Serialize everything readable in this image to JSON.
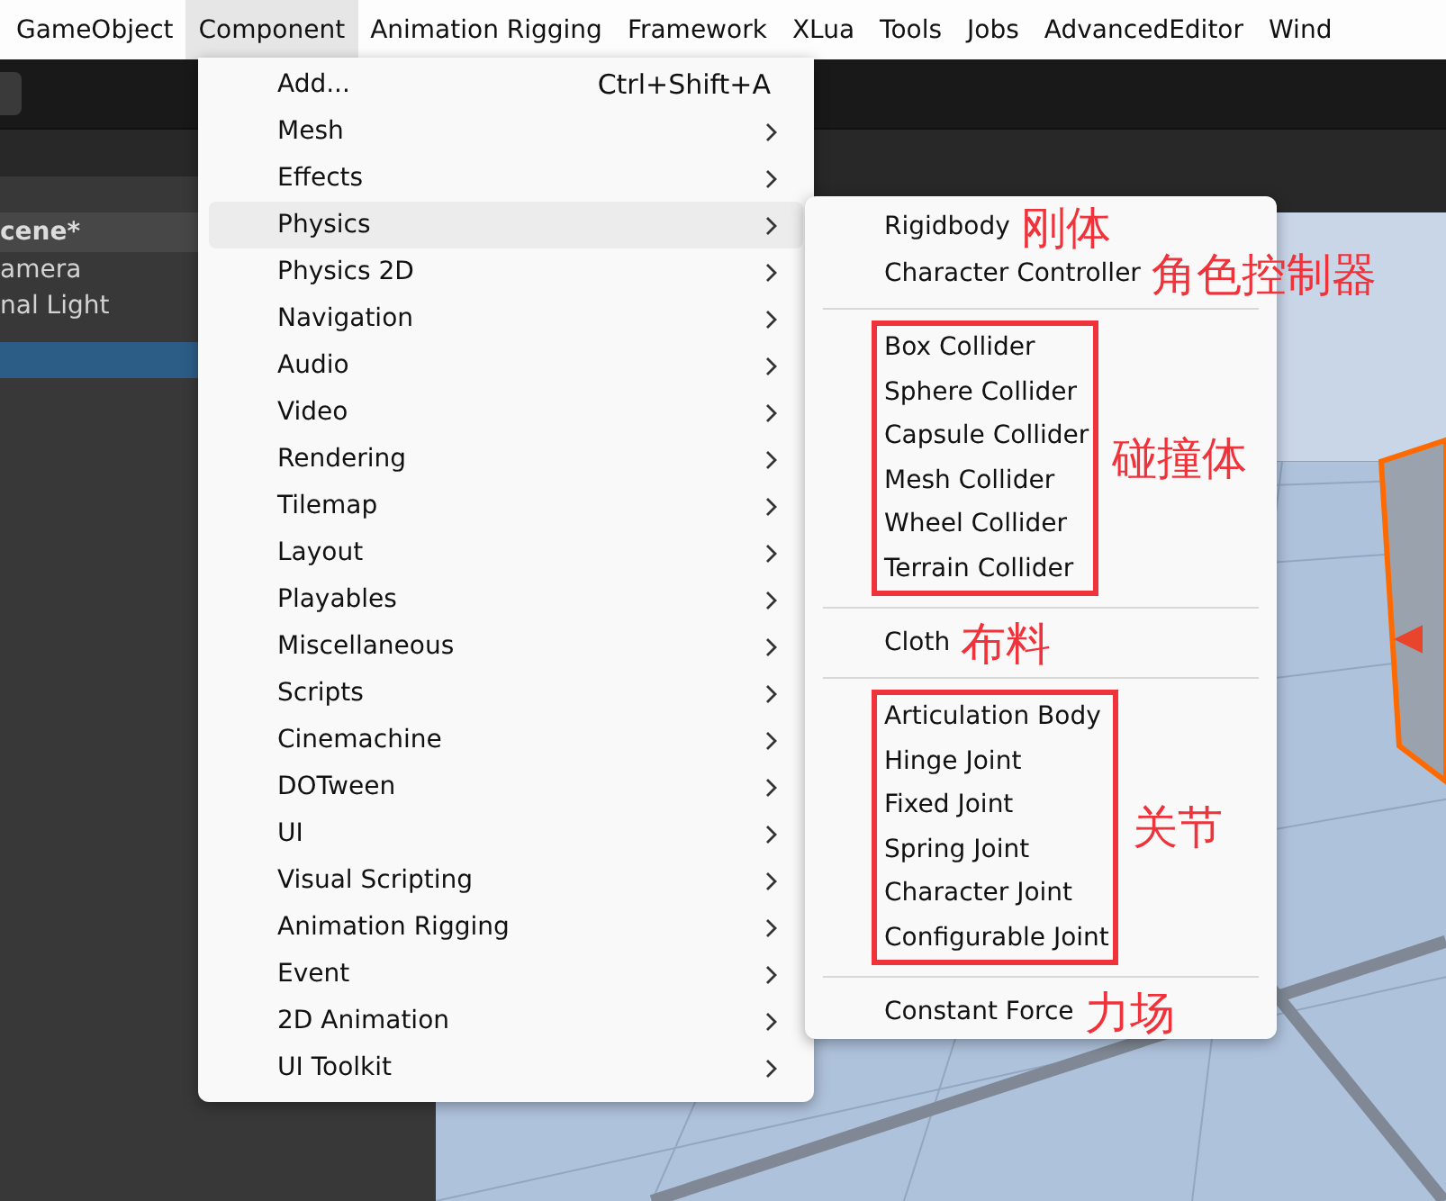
{
  "menubar": [
    {
      "label": "GameObject",
      "selected": false
    },
    {
      "label": "Component",
      "selected": true
    },
    {
      "label": "Animation Rigging",
      "selected": false
    },
    {
      "label": "Framework",
      "selected": false
    },
    {
      "label": "XLua",
      "selected": false
    },
    {
      "label": "Tools",
      "selected": false
    },
    {
      "label": "Jobs",
      "selected": false
    },
    {
      "label": "AdvancedEditor",
      "selected": false
    },
    {
      "label": "Wind",
      "selected": false
    }
  ],
  "hierarchy": {
    "title": "cene*",
    "items": [
      {
        "label": "amera",
        "selected": false
      },
      {
        "label": "nal Light",
        "selected": false
      },
      {
        "selected": true
      }
    ]
  },
  "menu": {
    "items": [
      {
        "label": "Add...",
        "shortcut": "Ctrl+Shift+A",
        "submenu": false,
        "selected": false
      },
      {
        "label": "Mesh",
        "submenu": true,
        "selected": false
      },
      {
        "label": "Effects",
        "submenu": true,
        "selected": false
      },
      {
        "label": "Physics",
        "submenu": true,
        "selected": true
      },
      {
        "label": "Physics 2D",
        "submenu": true,
        "selected": false
      },
      {
        "label": "Navigation",
        "submenu": true,
        "selected": false
      },
      {
        "label": "Audio",
        "submenu": true,
        "selected": false
      },
      {
        "label": "Video",
        "submenu": true,
        "selected": false
      },
      {
        "label": "Rendering",
        "submenu": true,
        "selected": false
      },
      {
        "label": "Tilemap",
        "submenu": true,
        "selected": false
      },
      {
        "label": "Layout",
        "submenu": true,
        "selected": false
      },
      {
        "label": "Playables",
        "submenu": true,
        "selected": false
      },
      {
        "label": "Miscellaneous",
        "submenu": true,
        "selected": false
      },
      {
        "label": "Scripts",
        "submenu": true,
        "selected": false
      },
      {
        "label": "Cinemachine",
        "submenu": true,
        "selected": false
      },
      {
        "label": "DOTween",
        "submenu": true,
        "selected": false
      },
      {
        "label": "UI",
        "submenu": true,
        "selected": false
      },
      {
        "label": "Visual Scripting",
        "submenu": true,
        "selected": false
      },
      {
        "label": "Animation Rigging",
        "submenu": true,
        "selected": false
      },
      {
        "label": "Event",
        "submenu": true,
        "selected": false
      },
      {
        "label": "2D Animation",
        "submenu": true,
        "selected": false
      },
      {
        "label": "UI Toolkit",
        "submenu": true,
        "selected": false
      }
    ]
  },
  "submenu": {
    "sections": [
      {
        "boxed": false,
        "items": [
          {
            "label": "Rigidbody",
            "note": "刚体"
          },
          {
            "label": "Character Controller",
            "note": "角色控制器"
          }
        ]
      },
      {
        "boxed": true,
        "note": "碰撞体",
        "items": [
          {
            "label": "Box Collider"
          },
          {
            "label": "Sphere Collider"
          },
          {
            "label": "Capsule Collider"
          },
          {
            "label": "Mesh Collider"
          },
          {
            "label": "Wheel Collider"
          },
          {
            "label": "Terrain Collider"
          }
        ]
      },
      {
        "boxed": false,
        "items": [
          {
            "label": "Cloth",
            "note": "布料"
          }
        ]
      },
      {
        "boxed": true,
        "note": "关节",
        "items": [
          {
            "label": "Articulation Body"
          },
          {
            "label": "Hinge Joint"
          },
          {
            "label": "Fixed Joint"
          },
          {
            "label": "Spring Joint"
          },
          {
            "label": "Character Joint"
          },
          {
            "label": "Configurable Joint"
          }
        ]
      },
      {
        "boxed": false,
        "items": [
          {
            "label": "Constant Force",
            "note": "力场"
          }
        ]
      }
    ]
  }
}
